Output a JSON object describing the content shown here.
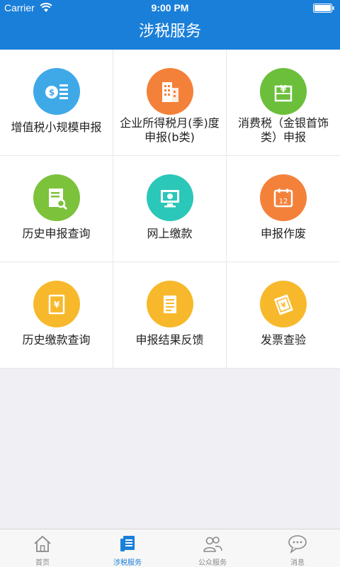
{
  "status_bar": {
    "carrier": "Carrier",
    "time": "9:00 PM"
  },
  "header": {
    "title": "涉税服务"
  },
  "grid": {
    "items": [
      {
        "label": "增值税小规模申报",
        "color": "#3fa9e8",
        "icon": "coin-document-icon"
      },
      {
        "label": "企业所得税月(季)度申报(b类)",
        "color": "#f4813a",
        "icon": "building-icon"
      },
      {
        "label": "消费税（金银首饰类）申报",
        "color": "#6bbf3a",
        "icon": "yuan-box-icon"
      },
      {
        "label": "历史申报查询",
        "color": "#7cc23b",
        "icon": "document-search-icon"
      },
      {
        "label": "网上缴款",
        "color": "#2bc7b8",
        "icon": "monitor-payment-icon"
      },
      {
        "label": "申报作废",
        "color": "#f4813a",
        "icon": "calendar-icon"
      },
      {
        "label": "历史缴款查询",
        "color": "#f7b92b",
        "icon": "yuan-document-icon"
      },
      {
        "label": "申报结果反馈",
        "color": "#f7b92b",
        "icon": "list-document-icon"
      },
      {
        "label": "发票查验",
        "color": "#f7b92b",
        "icon": "invoice-icon"
      }
    ]
  },
  "tabbar": {
    "tabs": [
      {
        "label": "首页",
        "icon": "home-icon",
        "active": false
      },
      {
        "label": "涉税服务",
        "icon": "tax-service-icon",
        "active": true
      },
      {
        "label": "公众服务",
        "icon": "people-icon",
        "active": false
      },
      {
        "label": "消息",
        "icon": "chat-bubble-icon",
        "active": false
      }
    ]
  },
  "colors": {
    "accent": "#1a7fd9",
    "inactive_tab": "#8a8a8a"
  }
}
